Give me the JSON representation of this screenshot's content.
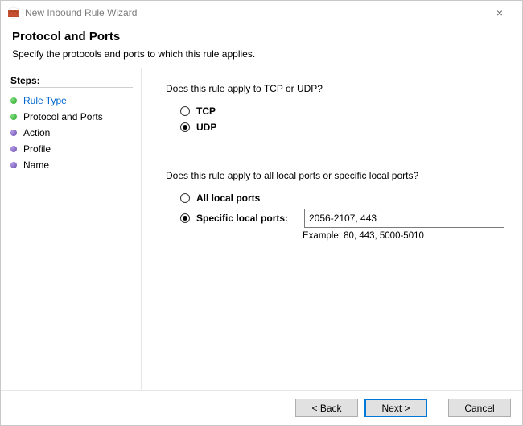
{
  "window": {
    "title": "New Inbound Rule Wizard"
  },
  "header": {
    "title": "Protocol and Ports",
    "subtitle": "Specify the protocols and ports to which this rule applies."
  },
  "sidebar": {
    "heading": "Steps:",
    "items": [
      {
        "label": "Rule Type",
        "state": "completed"
      },
      {
        "label": "Protocol and Ports",
        "state": "current"
      },
      {
        "label": "Action",
        "state": "pending"
      },
      {
        "label": "Profile",
        "state": "pending"
      },
      {
        "label": "Name",
        "state": "pending"
      }
    ]
  },
  "main": {
    "protocol_question": "Does this rule apply to TCP or UDP?",
    "protocol_options": {
      "tcp": "TCP",
      "udp": "UDP",
      "selected": "udp"
    },
    "ports_question": "Does this rule apply to all local ports or specific local ports?",
    "ports_options": {
      "all": "All local ports",
      "specific": "Specific local ports:",
      "selected": "specific"
    },
    "ports_value": "2056-2107, 443",
    "ports_example": "Example: 80, 443, 5000-5010"
  },
  "footer": {
    "back": "< Back",
    "next": "Next >",
    "cancel": "Cancel"
  }
}
